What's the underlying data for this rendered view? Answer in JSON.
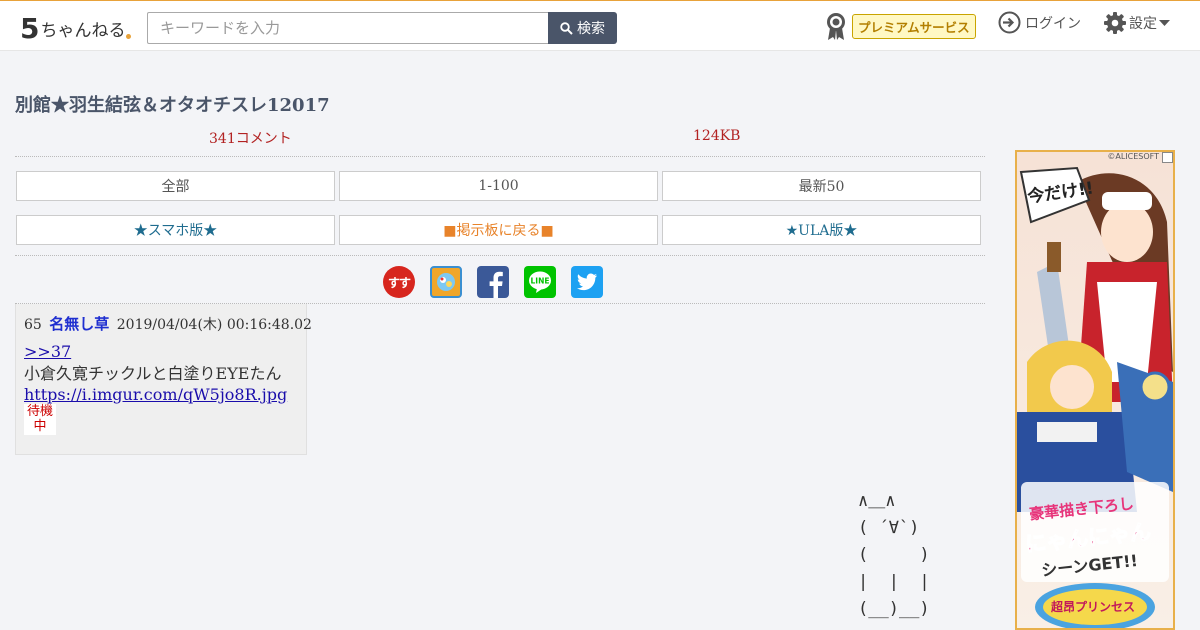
{
  "header": {
    "logo_num": "5",
    "logo_text": "ちゃんねる",
    "search_placeholder": "キーワードを入力",
    "search_label": "検索",
    "premium_label": "プレミアムサービス",
    "login_label": "ログイン",
    "settings_label": "設定"
  },
  "thread": {
    "title": "別館★羽生結弦＆オタオチスレ12017",
    "comments": "341コメント",
    "size": "124KB"
  },
  "nav": {
    "all": "全部",
    "range": "1-100",
    "latest": "最新50",
    "smartphone": "★スマホ版★",
    "back": "■掲示板に戻る■",
    "ula": "★ULA版★"
  },
  "share": {
    "ss_label": "すす"
  },
  "post": {
    "number": "65",
    "name": "名無し草",
    "date": "2019/04/04(木) 00:16:48.02",
    "anchor": ">>37",
    "text": "小倉久寛チックルと白塗りEYEたん",
    "link": "https://i.imgur.com/qW5jo8R.jpg",
    "wait_line1": "待機",
    "wait_line2": "中"
  },
  "ascii_art": "∧＿∧\n( ´∀`)\n(     )\n|  |  |\n(__)__)",
  "ad": {
    "copyright": "©ALICESOFT",
    "top_text": "今だけ!!",
    "line1": "豪華描き下ろし",
    "line2": "にゃんにゃん",
    "line3": "シーンGET!!",
    "logo": "超昂プリンセス"
  },
  "colors": {
    "header_accent": "#e8a23a",
    "search_button": "#4a5569",
    "title": "#4a5569",
    "meta": "#b22222",
    "name": "#1f2fd0"
  },
  "icons": [
    "search-icon",
    "premium-badge-icon",
    "login-icon",
    "gear-icon",
    "caret-down-icon",
    "facebook-icon",
    "line-icon",
    "twitter-icon"
  ]
}
